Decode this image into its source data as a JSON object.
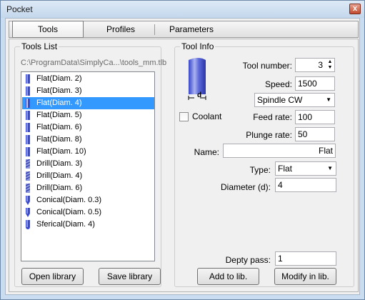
{
  "window": {
    "title": "Pocket",
    "close_glyph": "x"
  },
  "tabs": [
    {
      "label": "Tools"
    },
    {
      "label": "Profiles"
    },
    {
      "label": "Parameters"
    }
  ],
  "tools_list": {
    "title": "Tools List",
    "path": "C:\\ProgramData\\SimplyCa...\\tools_mm.tlb",
    "items": [
      {
        "label": "Flat(Diam. 2)",
        "icon": "flat-tool-icon"
      },
      {
        "label": "Flat(Diam. 3)",
        "icon": "flat-tool-icon"
      },
      {
        "label": "Flat(Diam. 4)",
        "icon": "flat-tool-icon",
        "selected": true
      },
      {
        "label": "Flat(Diam. 5)",
        "icon": "flat-tool-icon"
      },
      {
        "label": "Flat(Diam. 6)",
        "icon": "flat-tool-icon"
      },
      {
        "label": "Flat(Diam. 8)",
        "icon": "flat-tool-icon"
      },
      {
        "label": "Flat(Diam. 10)",
        "icon": "flat-tool-icon"
      },
      {
        "label": "Drill(Diam. 3)",
        "icon": "drill-tool-icon"
      },
      {
        "label": "Drill(Diam. 4)",
        "icon": "drill-tool-icon"
      },
      {
        "label": "Drill(Diam. 6)",
        "icon": "drill-tool-icon"
      },
      {
        "label": "Conical(Diam. 0.3)",
        "icon": "conical-tool-icon"
      },
      {
        "label": "Conical(Diam. 0.5)",
        "icon": "conical-tool-icon"
      },
      {
        "label": "Sferical(Diam. 4)",
        "icon": "spherical-tool-icon"
      }
    ],
    "open_library": "Open library",
    "save_library": "Save library"
  },
  "tool_info": {
    "title": "Tool Info",
    "preview_dim_label": "d",
    "coolant_label": "Coolant",
    "tool_number_label": "Tool number:",
    "tool_number": "3",
    "speed_label": "Speed:",
    "speed": "1500",
    "spindle": "Spindle CW",
    "feed_rate_label": "Feed rate:",
    "feed_rate": "100",
    "plunge_rate_label": "Plunge rate:",
    "plunge_rate": "50",
    "name_label": "Name:",
    "name": "Flat",
    "type_label": "Type:",
    "type": "Flat",
    "diameter_label": "Diameter (d):",
    "diameter": "4",
    "depth_pass_label": "Depty pass:",
    "depth_pass": "1",
    "add_to_lib": "Add to lib.",
    "modify_in_lib": "Modify in lib."
  },
  "colors": {
    "selection": "#3399ff",
    "tool_blue": "#3b4bd0"
  }
}
